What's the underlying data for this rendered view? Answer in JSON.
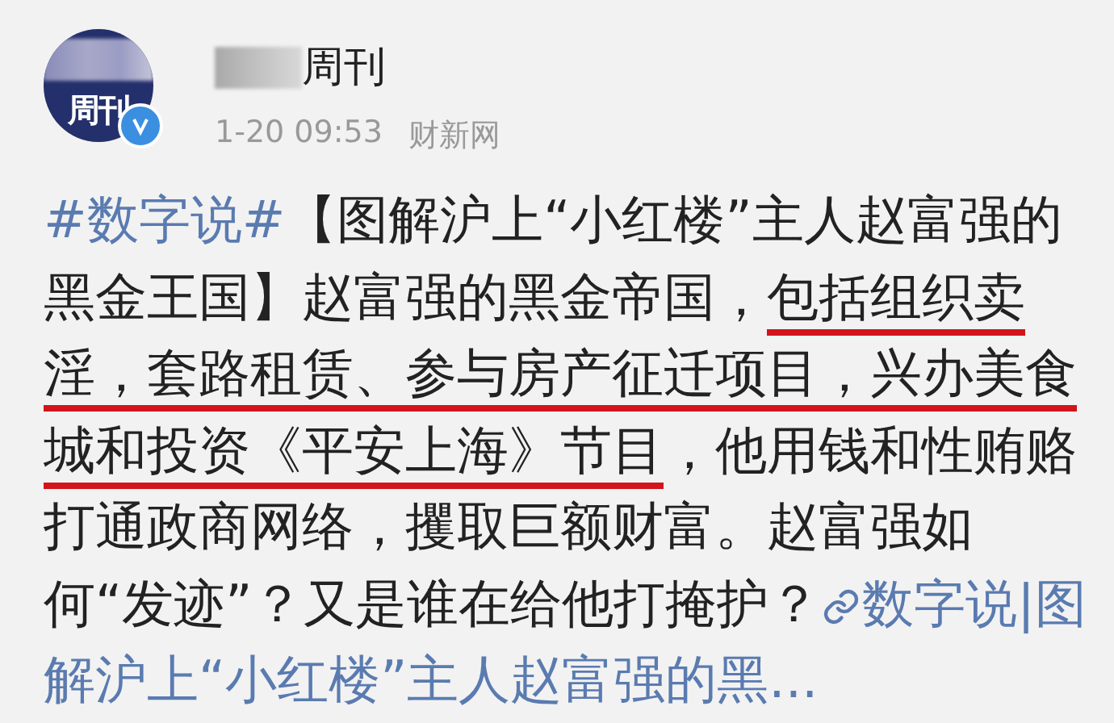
{
  "author": {
    "avatar_text": "周刊",
    "verified": true,
    "name": "周刊",
    "time": "1-20 09:53",
    "source": "财新网"
  },
  "post": {
    "segments": [
      {
        "kind": "hashtag",
        "text": "#数字说#"
      },
      {
        "kind": "plain",
        "text": "【图解沪上“小红楼”主人赵富强的黑金王国】赵富强的黑金帝国，"
      },
      {
        "kind": "underlined",
        "text": "包括组织卖淫，套路租赁、参与房产征迁项目，兴办美食城和投资《平安上海》节目"
      },
      {
        "kind": "plain",
        "text": "，他用钱和性贿赂打通政商网络，攫取巨额财富。赵富强如何“发迹”？又是谁在给他打掩护？"
      },
      {
        "kind": "link",
        "lines": [
          "数字说|图",
          "解沪上“小红楼”主人赵富强的黑..."
        ]
      }
    ]
  }
}
